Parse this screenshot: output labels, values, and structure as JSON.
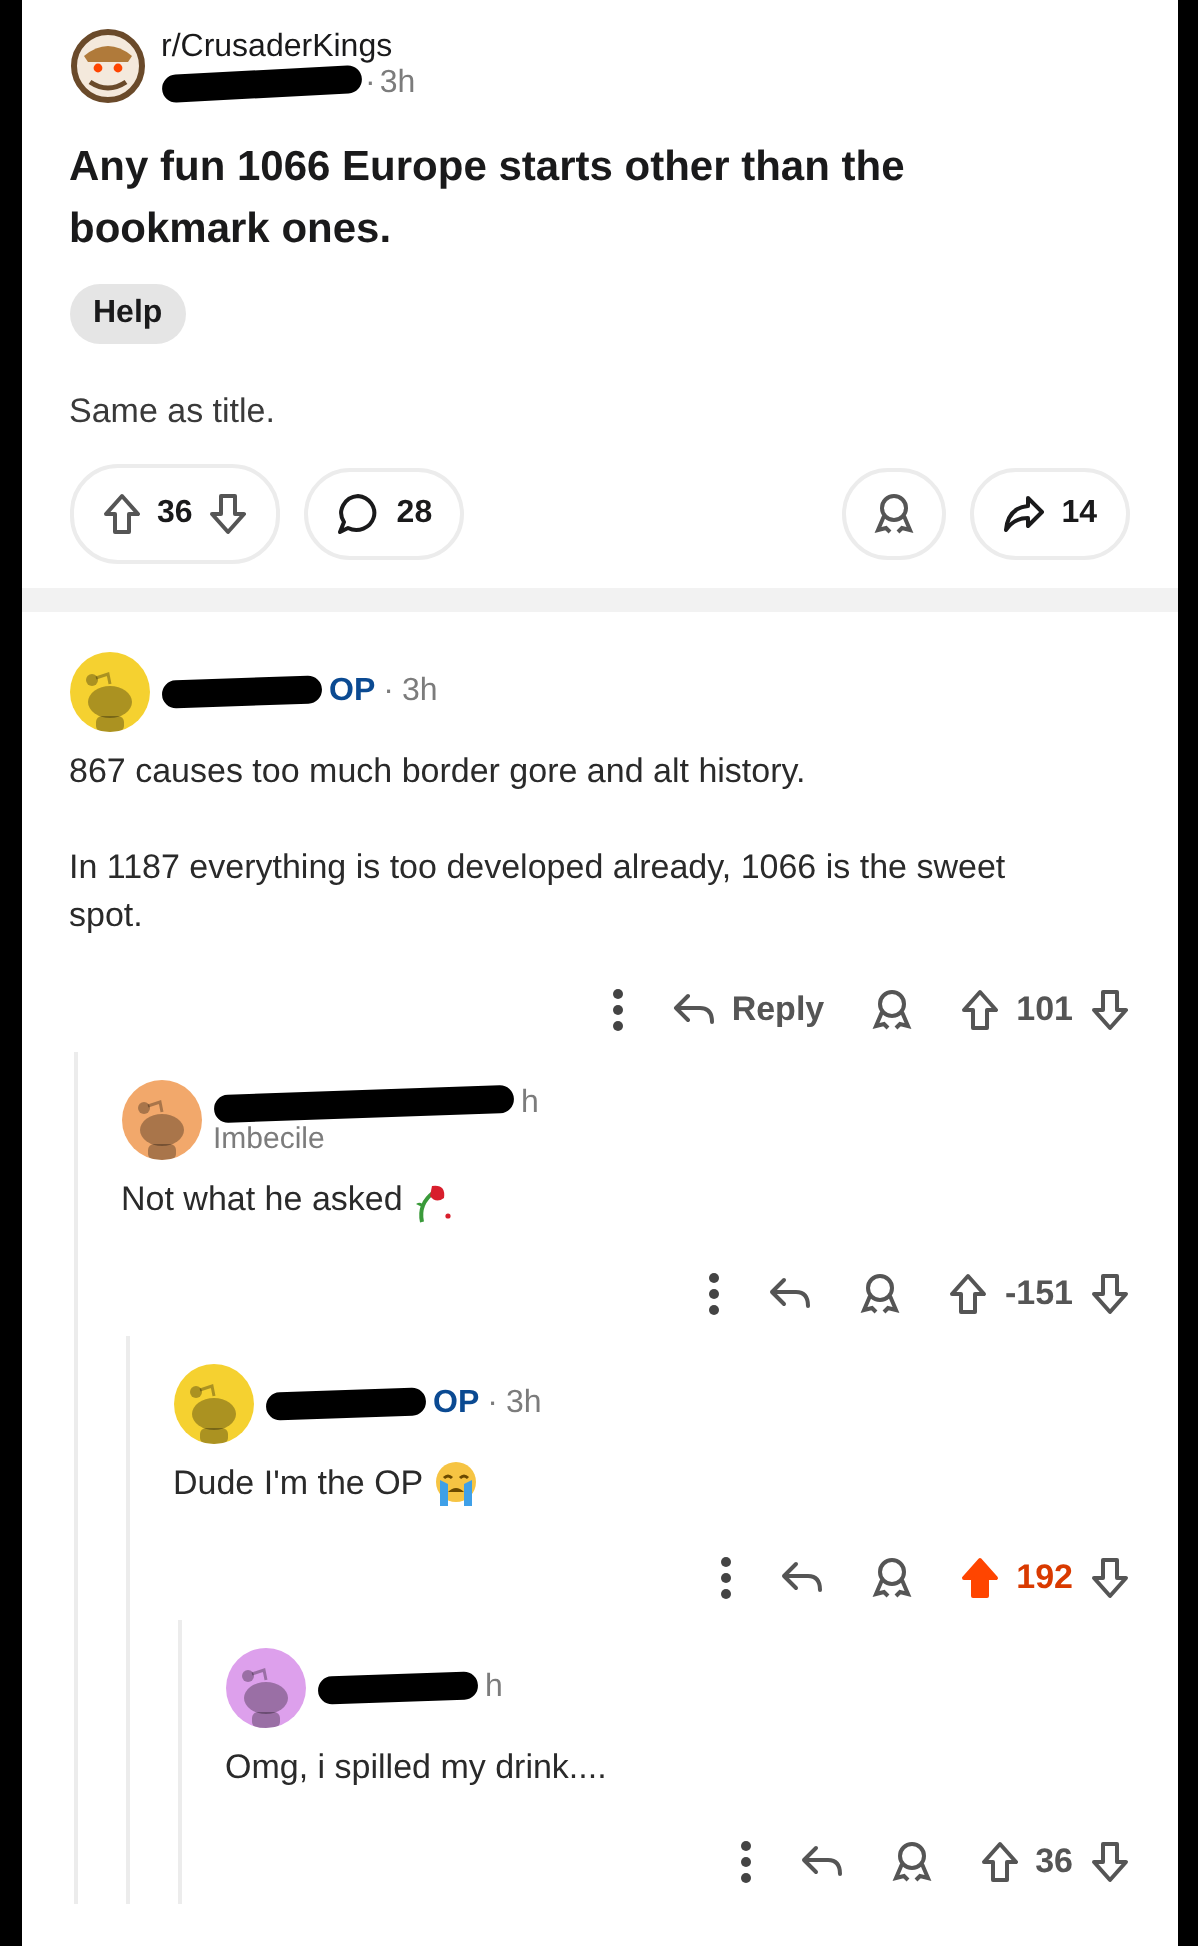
{
  "post": {
    "subreddit": "r/CrusaderKings",
    "separator": "·",
    "time": "3h",
    "title": "Any fun 1066 Europe starts other than the bookmark ones.",
    "flair": "Help",
    "body": "Same as title.",
    "votes": "36",
    "comments": "28",
    "shares": "14"
  },
  "comments": [
    {
      "color": "#f5d130",
      "op": "OP",
      "separator": "·",
      "time": "3h",
      "body": "867 causes too much border gore and alt history.\n\nIn 1187 everything is too developed already, 1066 is the sweet spot.",
      "reply_label": "Reply",
      "score": "101",
      "upvoted": false,
      "children": [
        {
          "color": "#f2a86b",
          "time": "h",
          "flair": "Imbecile",
          "body": "Not what he asked",
          "emoji": {
            "kind": "wilted-rose"
          },
          "score": "-151",
          "upvoted": false,
          "children": [
            {
              "color": "#f5d130",
              "op": "OP",
              "separator": "·",
              "time": "3h",
              "body": "Dude I'm the OP",
              "emoji": {
                "kind": "crying"
              },
              "score": "192",
              "upvoted": true,
              "children": [
                {
                  "color": "#dda0ec",
                  "time": "h",
                  "body": "Omg, i spilled my drink....",
                  "score": "36",
                  "upvoted": false
                }
              ]
            }
          ]
        }
      ]
    }
  ]
}
